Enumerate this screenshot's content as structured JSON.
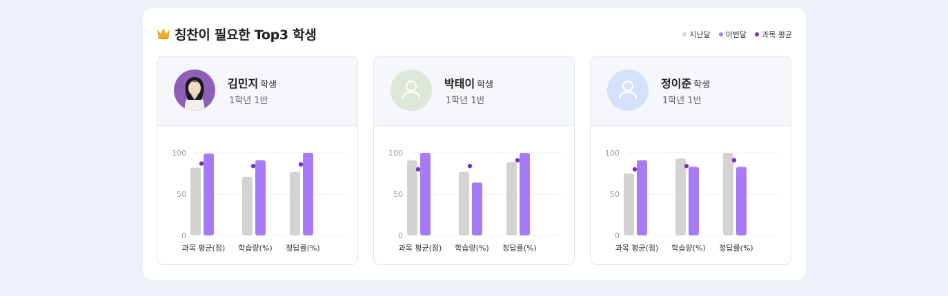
{
  "header": {
    "title": "칭찬이 필요한 Top3 학생",
    "crown_icon": "crown-icon"
  },
  "legend": [
    {
      "label": "지난달",
      "color": "#d3d3d3"
    },
    {
      "label": "이번달",
      "color": "#a57cf5"
    },
    {
      "label": "과목 평균",
      "color": "#7d2fc9"
    }
  ],
  "students": [
    {
      "name": "김민지",
      "suffix": "학생",
      "class": "1학년 1반",
      "avatar": "photo"
    },
    {
      "name": "박태이",
      "suffix": "학생",
      "class": "1학년 1반",
      "avatar": "placeholder-green"
    },
    {
      "name": "정이준",
      "suffix": "학생",
      "class": "1학년 1반",
      "avatar": "placeholder-blue"
    }
  ],
  "colors": {
    "last_month": "#d3d3d3",
    "this_month": "#a57cf5",
    "average": "#7d2fc9",
    "avatar_green_bg": "#dde8d9",
    "avatar_blue_bg": "#d4e1fb",
    "avatar_photo_bg": "#8e5fb8"
  },
  "chart_data": [
    {
      "type": "bar",
      "categories": [
        "과목 평균(점)",
        "학습량(%)",
        "정답률(%)"
      ],
      "yticks": [
        "0",
        "50",
        "100"
      ],
      "ylim": [
        0,
        100
      ],
      "series": [
        {
          "name": "지난달",
          "values": [
            82,
            71,
            77
          ]
        },
        {
          "name": "이번달",
          "values": [
            99,
            91,
            100
          ]
        },
        {
          "name": "과목 평균",
          "values": [
            87,
            84,
            86
          ]
        }
      ]
    },
    {
      "type": "bar",
      "categories": [
        "과목 평균(점)",
        "학습량(%)",
        "정답률(%)"
      ],
      "yticks": [
        "0",
        "50",
        "100"
      ],
      "ylim": [
        0,
        100
      ],
      "series": [
        {
          "name": "지난달",
          "values": [
            91,
            77,
            89
          ]
        },
        {
          "name": "이번달",
          "values": [
            100,
            64,
            100
          ]
        },
        {
          "name": "과목 평균",
          "values": [
            80,
            84,
            91
          ]
        }
      ]
    },
    {
      "type": "bar",
      "categories": [
        "과목 평균(점)",
        "학습량(%)",
        "정답률(%)"
      ],
      "yticks": [
        "0",
        "50",
        "100"
      ],
      "ylim": [
        0,
        100
      ],
      "series": [
        {
          "name": "지난달",
          "values": [
            75,
            93,
            100
          ]
        },
        {
          "name": "이번달",
          "values": [
            91,
            83,
            83
          ]
        },
        {
          "name": "과목 평균",
          "values": [
            80,
            84,
            91
          ]
        }
      ]
    }
  ]
}
